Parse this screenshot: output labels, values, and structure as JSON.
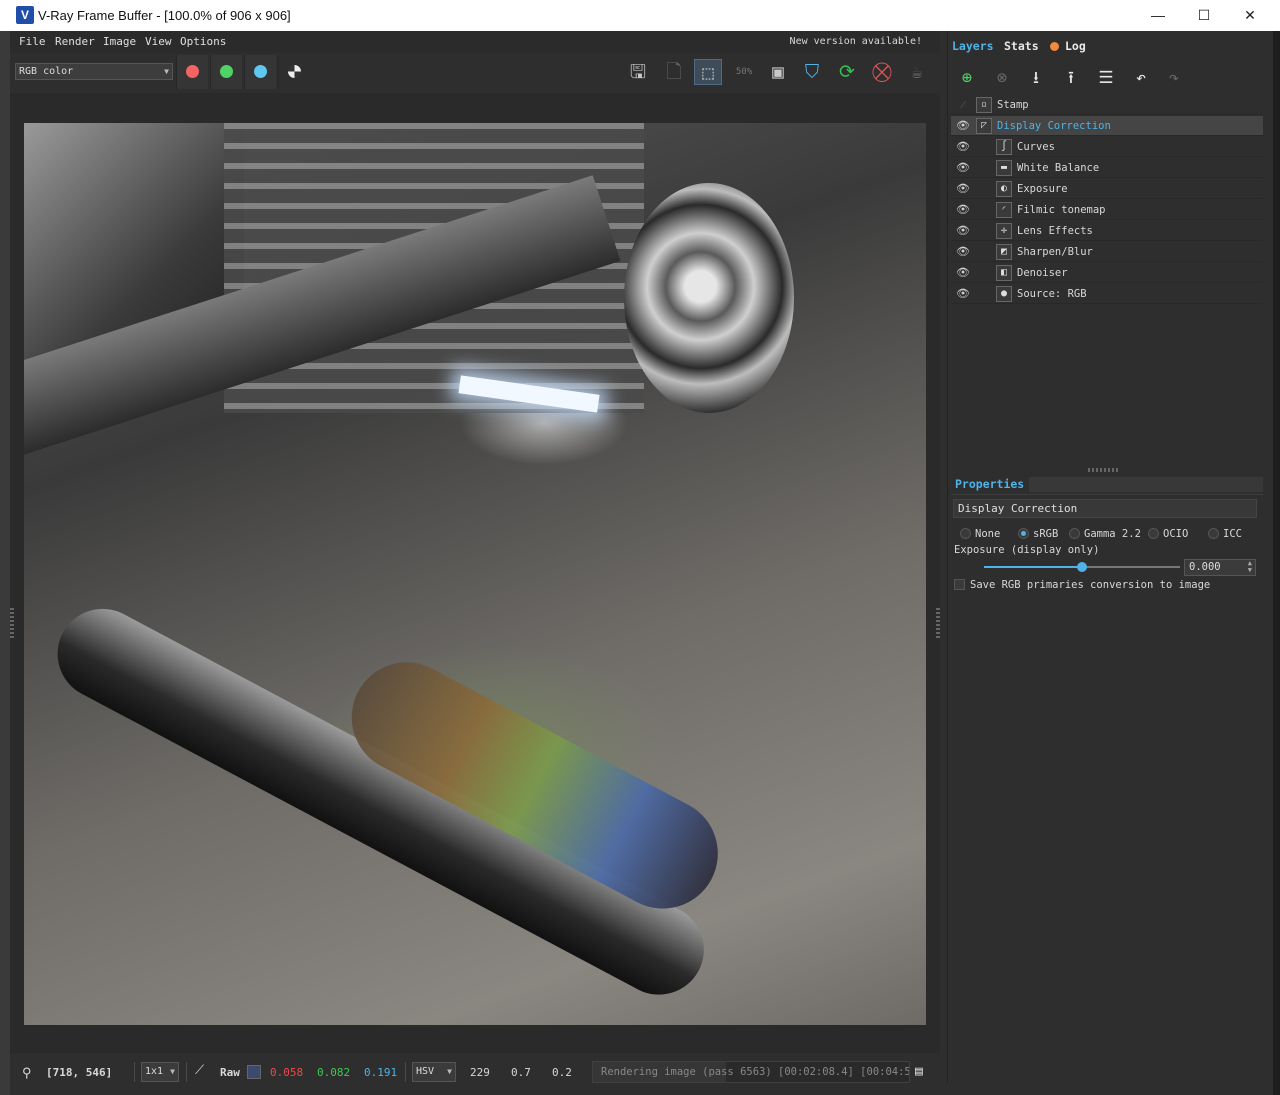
{
  "window": {
    "title": "V-Ray Frame Buffer - [100.0% of 906 x 906]",
    "app_icon": "V",
    "minimize": "—",
    "maximize": "☐",
    "close": "✕"
  },
  "menu": {
    "items": [
      "File",
      "Render",
      "Image",
      "View",
      "Options"
    ],
    "notice": "New version available!"
  },
  "toolbar": {
    "channel": "RGB color",
    "channel_colors": {
      "red": "#f26363",
      "green": "#4ed464",
      "blue": "#5ec8f2"
    },
    "zoom_label": "50%",
    "icons": [
      "save-icon",
      "clear-icon",
      "region-render-icon",
      "zoom-50-icon",
      "region-icon",
      "track-mouse-icon",
      "refresh-icon",
      "stop-render-icon",
      "teapot-icon"
    ]
  },
  "status": {
    "coords": "[718, 546]",
    "sample_mode": "1x1",
    "raw_label": "Raw",
    "swatch_color": "#3b4a6e",
    "r": "0.058",
    "g": "0.082",
    "b": "0.191",
    "color_space": "HSV",
    "h": "229",
    "s": "0.7",
    "v": "0.2",
    "progress_text": "Rendering image (pass 6563) [00:02:08.4] [00:04:5",
    "progress_fraction": 0.42
  },
  "right_panel": {
    "tabs": {
      "layers": "Layers",
      "stats": "Stats",
      "log": "Log"
    },
    "layers": [
      {
        "name": "Stamp",
        "icon": "stamp-icon",
        "glyph": "▫",
        "visible": false,
        "indent": 0,
        "selected": false
      },
      {
        "name": "Display Correction",
        "icon": "display-correction-icon",
        "glyph": "◸",
        "visible": true,
        "indent": 0,
        "selected": true
      },
      {
        "name": "Curves",
        "icon": "curves-icon",
        "glyph": "∫",
        "visible": true,
        "indent": 1,
        "selected": false
      },
      {
        "name": "White Balance",
        "icon": "white-balance-icon",
        "glyph": "▬",
        "visible": true,
        "indent": 1,
        "selected": false
      },
      {
        "name": "Exposure",
        "icon": "exposure-icon",
        "glyph": "◐",
        "visible": true,
        "indent": 1,
        "selected": false
      },
      {
        "name": "Filmic tonemap",
        "icon": "filmic-tonemap-icon",
        "glyph": "◜",
        "visible": true,
        "indent": 1,
        "selected": false
      },
      {
        "name": "Lens Effects",
        "icon": "lens-effects-icon",
        "glyph": "✛",
        "visible": true,
        "indent": 1,
        "selected": false
      },
      {
        "name": "Sharpen/Blur",
        "icon": "sharpen-blur-icon",
        "glyph": "◩",
        "visible": true,
        "indent": 1,
        "selected": false
      },
      {
        "name": "Denoiser",
        "icon": "denoiser-icon",
        "glyph": "◧",
        "visible": true,
        "indent": 1,
        "selected": false
      },
      {
        "name": "Source: RGB",
        "icon": "source-rgb-icon",
        "glyph": "●",
        "visible": true,
        "indent": 1,
        "selected": false
      }
    ],
    "properties": {
      "title": "Properties",
      "layer_name": "Display Correction",
      "modes": [
        {
          "label": "None",
          "selected": false
        },
        {
          "label": "sRGB",
          "selected": true
        },
        {
          "label": "Gamma 2.2",
          "selected": false
        },
        {
          "label": "OCIO",
          "selected": false
        },
        {
          "label": "ICC",
          "selected": false
        }
      ],
      "exposure_label": "Exposure (display only)",
      "exposure_value": "0.000",
      "exposure_slider_fraction": 0.5,
      "save_rgb_label": "Save RGB primaries conversion to image"
    }
  }
}
